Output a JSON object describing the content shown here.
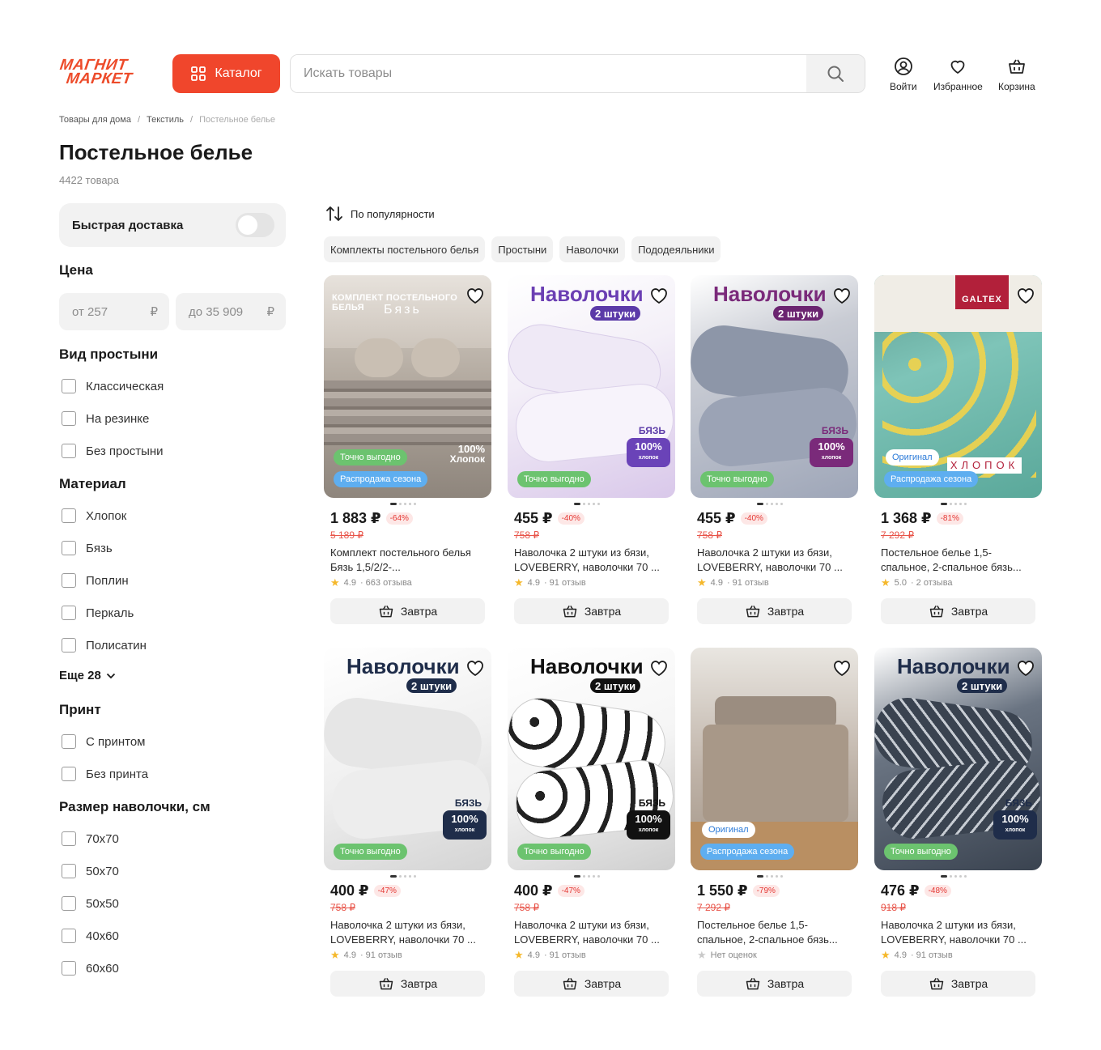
{
  "header": {
    "logo_line1": "МАГНИТ",
    "logo_line2": "МАРКЕТ",
    "catalog_label": "Каталог",
    "search_placeholder": "Искать товары",
    "login_label": "Войти",
    "favorites_label": "Избранное",
    "cart_label": "Корзина"
  },
  "breadcrumb": [
    "Товары для дома",
    "Текстиль",
    "Постельное белье"
  ],
  "page": {
    "title": "Постельное белье",
    "count": "4422 товара"
  },
  "sidebar": {
    "fast_delivery": "Быстрая доставка",
    "price": {
      "title": "Цена",
      "from": "от 257",
      "to": "до 35 909",
      "currency": "₽"
    },
    "sheet_type": {
      "title": "Вид простыни",
      "options": [
        "Классическая",
        "На резинке",
        "Без простыни"
      ]
    },
    "material": {
      "title": "Материал",
      "options": [
        "Хлопок",
        "Бязь",
        "Поплин",
        "Перкаль",
        "Полисатин"
      ],
      "more": "Еще 28"
    },
    "print": {
      "title": "Принт",
      "options": [
        "С принтом",
        "Без принта"
      ]
    },
    "pillow_size": {
      "title": "Размер наволочки, см",
      "options": [
        "70х70",
        "50х70",
        "50х50",
        "40х60",
        "60х60"
      ]
    }
  },
  "sort": {
    "label": "По популярности"
  },
  "chips": [
    "Комплекты постельного белья",
    "Простыни",
    "Наволочки",
    "Пододеяльники"
  ],
  "badges": {
    "deal": "Точно выгодно",
    "sale": "Распродажа сезона",
    "original": "Оригинал",
    "naval_title": "Наволочки",
    "naval_sub": "2 штуки",
    "bz_top": "БЯЗЬ",
    "bz_pct": "100%",
    "bz_bottom": "хлопок",
    "set_title": "КОМПЛЕКТ ПОСТЕЛЬНОГО БЕЛЬЯ",
    "set_sub": "Бязь",
    "set_cotton_pct": "100%",
    "set_cotton": "Хлопок",
    "galtex": "GALTEX",
    "cotton_word": "ХЛОПОК"
  },
  "products": [
    {
      "price": "1 883 ₽",
      "discount": "-64%",
      "old_price": "5 189 ₽",
      "name": "Комплект постельного белья Бязь 1,5/2/2-...",
      "rating": "4.9",
      "reviews": "· 663 отзыва",
      "delivery": "Завтра"
    },
    {
      "price": "455 ₽",
      "discount": "-40%",
      "old_price": "758 ₽",
      "name": "Наволочка 2 штуки из бязи, LOVEBERRY, наволочки 70 ...",
      "rating": "4.9",
      "reviews": "· 91 отзыв",
      "delivery": "Завтра"
    },
    {
      "price": "455 ₽",
      "discount": "-40%",
      "old_price": "758 ₽",
      "name": "Наволочка 2 штуки из бязи, LOVEBERRY, наволочки 70 ...",
      "rating": "4.9",
      "reviews": "· 91 отзыв",
      "delivery": "Завтра"
    },
    {
      "price": "1 368 ₽",
      "discount": "-81%",
      "old_price": "7 292 ₽",
      "name": "Постельное белье 1,5-спальное, 2-спальное бязь...",
      "rating": "5.0",
      "reviews": "· 2 отзыва",
      "delivery": "Завтра"
    },
    {
      "price": "400 ₽",
      "discount": "-47%",
      "old_price": "758 ₽",
      "name": "Наволочка 2 штуки из бязи, LOVEBERRY, наволочки 70 ...",
      "rating": "4.9",
      "reviews": "· 91 отзыв",
      "delivery": "Завтра"
    },
    {
      "price": "400 ₽",
      "discount": "-47%",
      "old_price": "758 ₽",
      "name": "Наволочка 2 штуки из бязи, LOVEBERRY, наволочки 70 ...",
      "rating": "4.9",
      "reviews": "· 91 отзыв",
      "delivery": "Завтра"
    },
    {
      "price": "1 550 ₽",
      "discount": "-79%",
      "old_price": "7 292 ₽",
      "name": "Постельное белье 1,5-спальное, 2-спальное бязь...",
      "rating": "",
      "reviews": "Нет оценок",
      "delivery": "Завтра"
    },
    {
      "price": "476 ₽",
      "discount": "-48%",
      "old_price": "918 ₽",
      "name": "Наволочка 2 штуки из бязи, LOVEBERRY, наволочки 70 ...",
      "rating": "4.9",
      "reviews": "· 91 отзыв",
      "delivery": "Завтра"
    }
  ],
  "colors": {
    "accent": "#f0462c",
    "deal_badge": "#6cc36f",
    "sale_badge": "#5eaef0",
    "discount": "#e53935"
  }
}
